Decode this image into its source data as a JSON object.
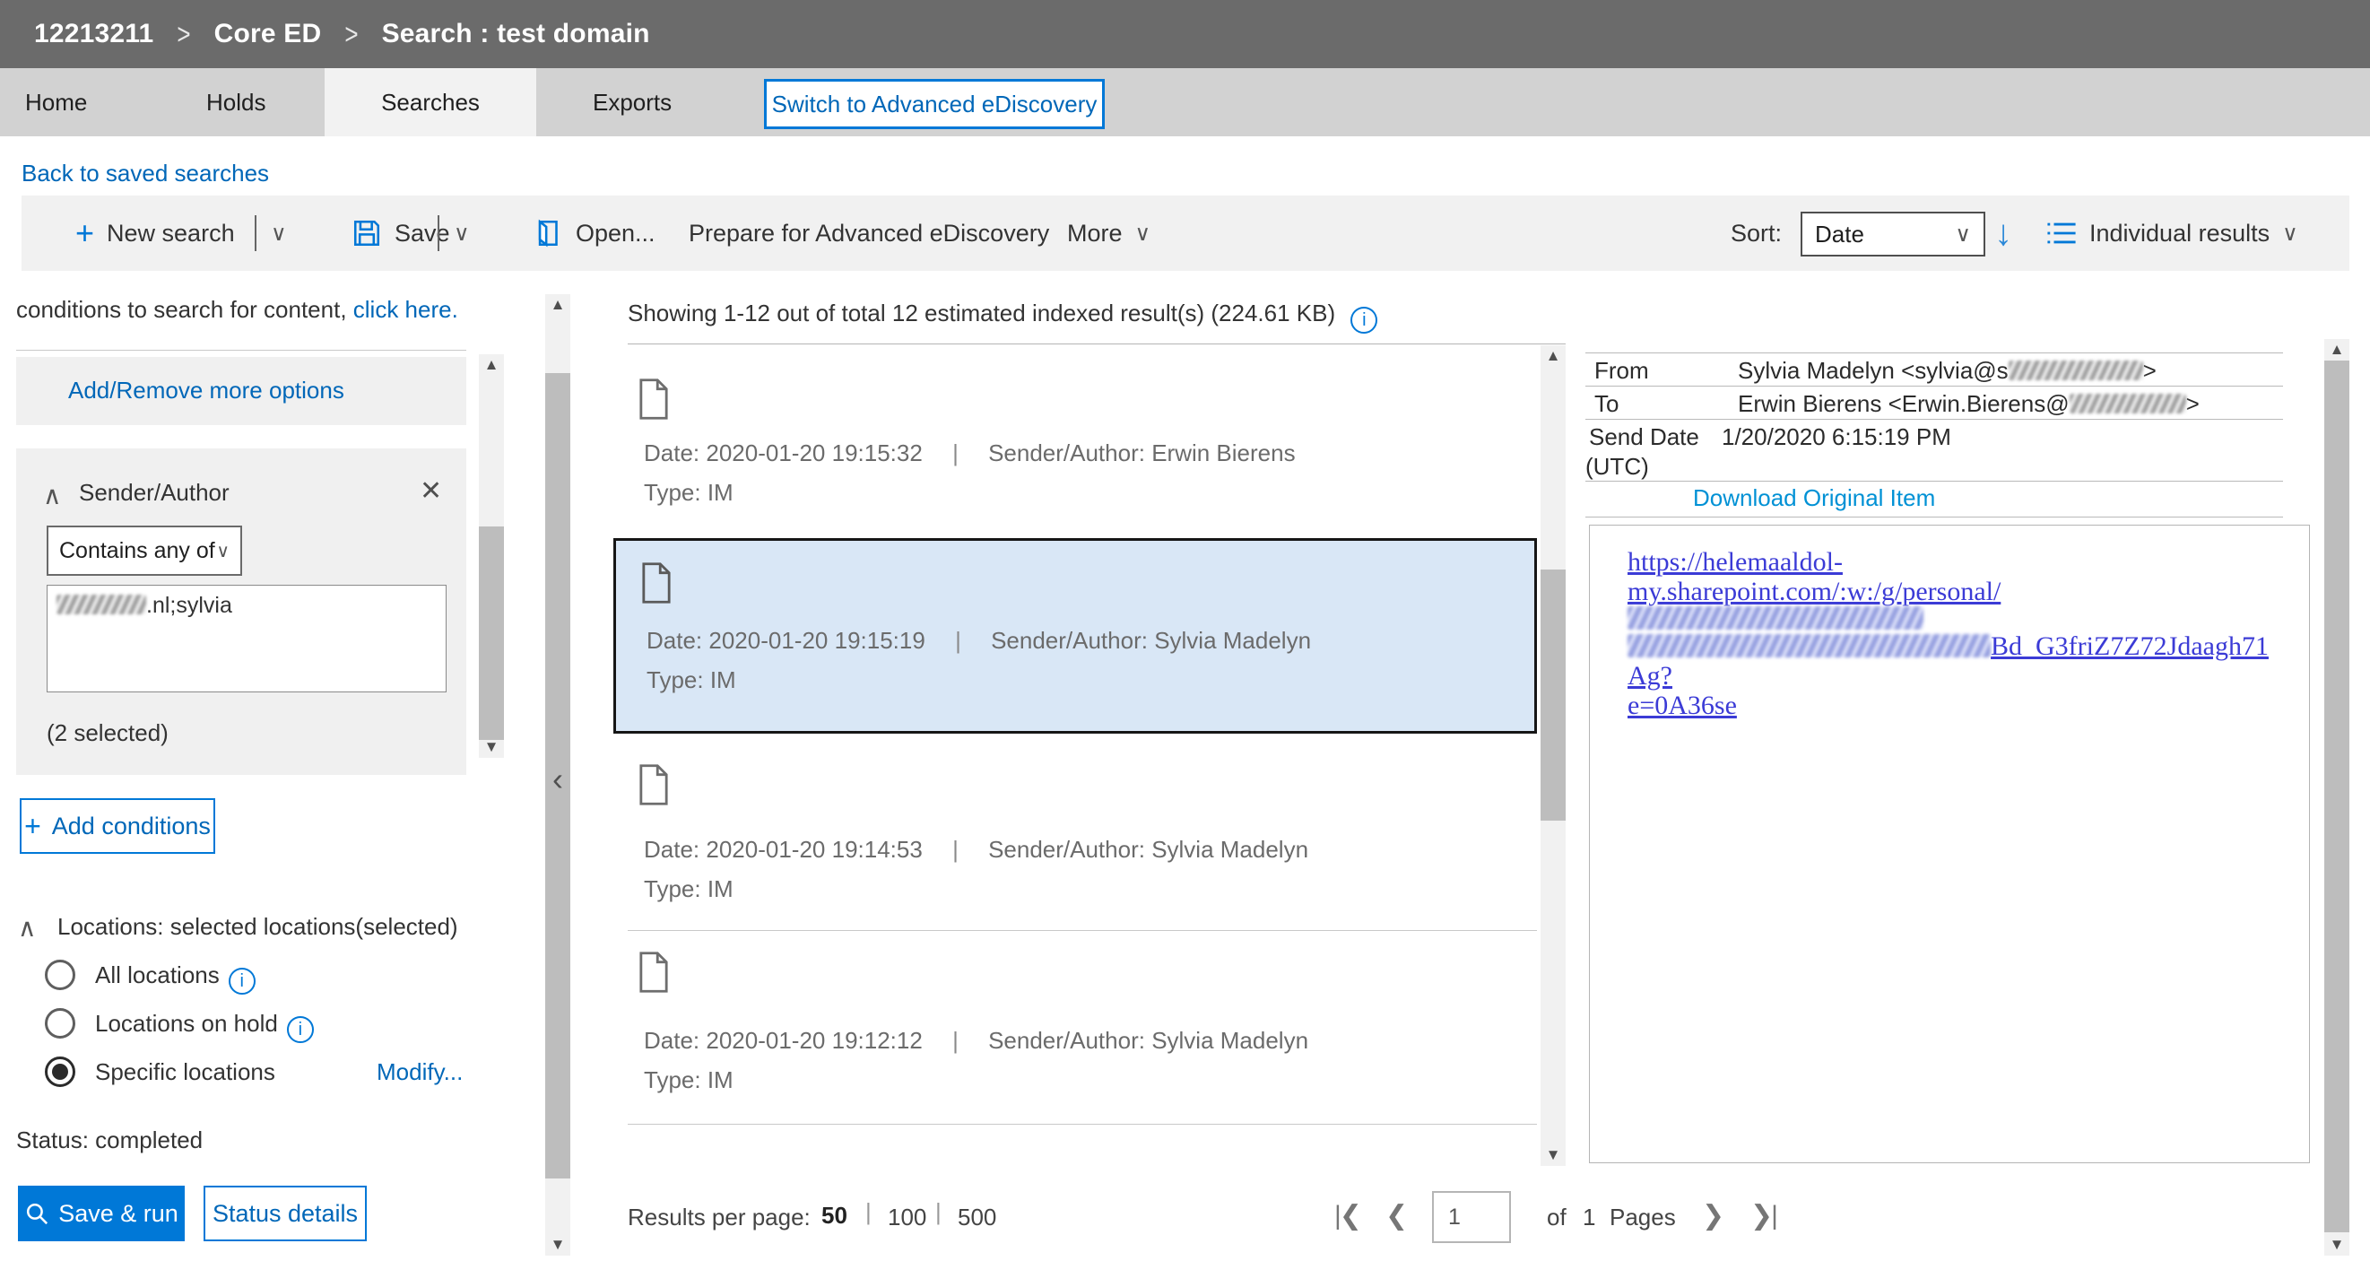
{
  "breadcrumb": {
    "case_id": "12213211",
    "section": "Core ED",
    "page": "Search : test domain",
    "separator": ">"
  },
  "tabs": {
    "home": "Home",
    "holds": "Holds",
    "searches": "Searches",
    "exports": "Exports",
    "active": "Searches"
  },
  "switch_button": "Switch to Advanced eDiscovery",
  "back_link": "Back to saved searches",
  "toolbar": {
    "new_search": "New search",
    "save": "Save",
    "open": "Open...",
    "prepare": "Prepare for Advanced eDiscovery",
    "more": "More",
    "sort_label": "Sort:",
    "sort_value": "Date",
    "view_mode": "Individual results"
  },
  "left_panel": {
    "intro_text": "conditions to search for content,",
    "intro_link": "click here.",
    "add_remove_link": "Add/Remove more options",
    "condition": {
      "title": "Sender/Author",
      "operator": "Contains any of",
      "value_visible": ".nl;sylvia",
      "selected_note": "(2 selected)"
    },
    "add_conditions": "Add conditions",
    "locations": {
      "heading": "Locations: selected locations(selected)",
      "option_all": "All locations",
      "option_hold": "Locations on hold",
      "option_specific": "Specific locations",
      "selected_option": "Specific locations",
      "modify_link": "Modify..."
    },
    "status_text": "Status: completed",
    "save_run": "Save & run",
    "status_details": "Status details"
  },
  "results": {
    "summary": "Showing 1-12 out of total 12 estimated indexed result(s) (224.61 KB)",
    "labels": {
      "date": "Date:",
      "sender": "Sender/Author:",
      "type": "Type:"
    },
    "items": [
      {
        "date": "2020-01-20 19:15:32",
        "sender": "Erwin Bierens",
        "type": "IM",
        "selected": false
      },
      {
        "date": "2020-01-20 19:15:19",
        "sender": "Sylvia Madelyn",
        "type": "IM",
        "selected": true
      },
      {
        "date": "2020-01-20 19:14:53",
        "sender": "Sylvia Madelyn",
        "type": "IM",
        "selected": false
      },
      {
        "date": "2020-01-20 19:12:12",
        "sender": "Sylvia Madelyn",
        "type": "IM",
        "selected": false
      }
    ],
    "pagination": {
      "results_per_page_label": "Results per page:",
      "size_50": "50",
      "size_100": "100",
      "size_500": "500",
      "current_size": "50",
      "page_value": "1",
      "of_label": "of",
      "pages_count": "1",
      "pages_label": "Pages"
    }
  },
  "detail_panel": {
    "from_label": "From",
    "from_value_prefix": "Sylvia Madelyn <sylvia@s",
    "from_value_suffix": ">",
    "to_label": "To",
    "to_value_prefix": "Erwin Bierens <Erwin.Bierens@",
    "to_value_suffix": ">",
    "send_date_label": "Send Date",
    "send_date_value": "1/20/2020 6:15:19 PM",
    "utc_label": "(UTC)",
    "download_link": "Download Original Item",
    "body_link": {
      "line1": "https://helemaaldol-",
      "line2": "my.sharepoint.com/:w:/g/personal/",
      "line3_tail": "Bd_G3friZ7Z72Jdaagh71Ag?",
      "line4": "e=0A36se"
    }
  },
  "colors": {
    "accent": "#0078d7",
    "link": "#0067b8",
    "header_bg": "#6b6b6b",
    "tabbar_bg": "#d2d2d2",
    "active_tab_bg": "#f2f2f2",
    "toolbar_bg": "#f1f1f1",
    "selected_item_bg": "#d9e7f6",
    "panel_box_bg": "#f0f0f0"
  }
}
